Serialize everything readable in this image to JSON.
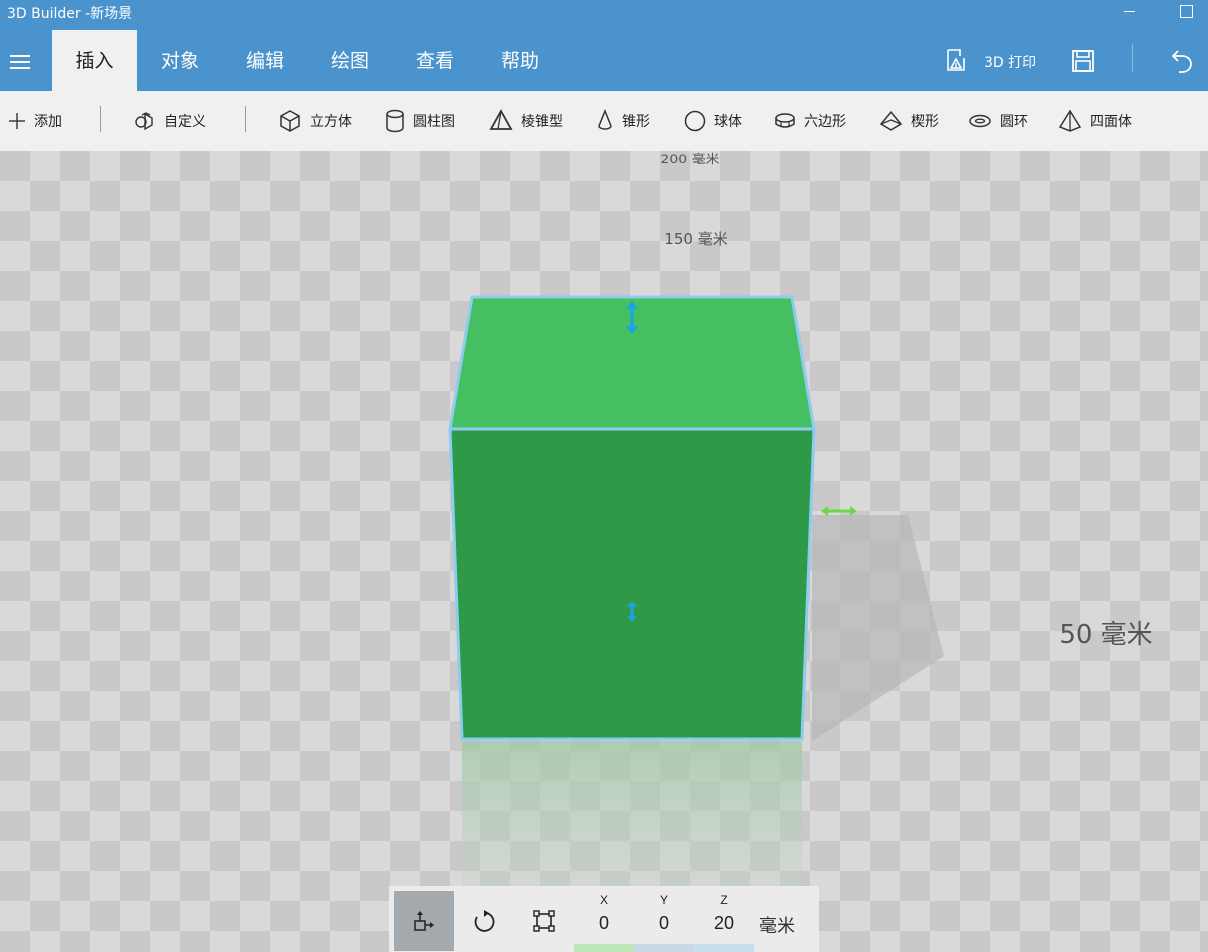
{
  "window": {
    "title": "3D Builder -新场景"
  },
  "ribbon": {
    "tabs": [
      {
        "label": "插入",
        "active": true
      },
      {
        "label": "对象",
        "active": false
      },
      {
        "label": "编辑",
        "active": false
      },
      {
        "label": "绘图",
        "active": false
      },
      {
        "label": "查看",
        "active": false
      },
      {
        "label": "帮助",
        "active": false
      }
    ],
    "print_label": "3D 打印",
    "colors": {
      "accent": "#4a93cd",
      "active_tab_bg": "#f0f0f0"
    }
  },
  "toolbar": {
    "add_label": "添加",
    "custom_label": "自定义",
    "shapes": [
      {
        "label": "立方体",
        "icon": "cube-icon"
      },
      {
        "label": "圆柱图",
        "icon": "cylinder-icon"
      },
      {
        "label": "棱锥型",
        "icon": "pyramid-icon"
      },
      {
        "label": "锥形",
        "icon": "cone-icon"
      },
      {
        "label": "球体",
        "icon": "sphere-icon"
      },
      {
        "label": "六边形",
        "icon": "hexagon-icon"
      },
      {
        "label": "楔形",
        "icon": "wedge-icon"
      },
      {
        "label": "圆环",
        "icon": "torus-icon"
      },
      {
        "label": "四面体",
        "icon": "tetrahedron-icon"
      }
    ]
  },
  "scene": {
    "ruler_labels": [
      "200 毫米",
      "150 毫米",
      "50 毫米"
    ],
    "object": {
      "type": "cube",
      "color_top": "#45c060",
      "color_front": "#2e9a48",
      "outline": "#8ecbf0"
    }
  },
  "controls": {
    "coords": [
      {
        "axis": "X",
        "value": "0",
        "color": "#bde6b8"
      },
      {
        "axis": "Y",
        "value": "0",
        "color": "#c9d8e6"
      },
      {
        "axis": "Z",
        "value": "20",
        "color": "#c8dff0"
      }
    ],
    "unit": "毫米"
  }
}
